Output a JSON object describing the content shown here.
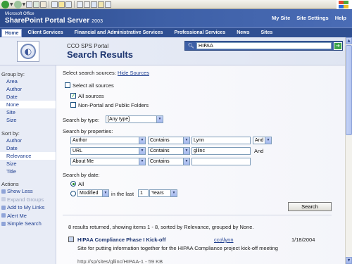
{
  "banner": {
    "brand_small": "Microsoft Office",
    "brand_large": "SharePoint Portal Server",
    "brand_year": "2003",
    "links": [
      "My Site",
      "Site Settings",
      "Help"
    ]
  },
  "nav": {
    "items": [
      "Home",
      "Client Services",
      "Financial and Administrative Services",
      "Professional Services",
      "News",
      "Sites"
    ]
  },
  "header": {
    "portal_title": "CCO SPS Portal",
    "page_title": "Search Results",
    "search_value": "HIPAA",
    "search_go_icon": "arrow-right-icon"
  },
  "sidebar": {
    "group_by_heading": "Group by:",
    "group_by": [
      "Area",
      "Author",
      "Date",
      "None",
      "Site",
      "Size"
    ],
    "group_by_selected": "None",
    "sort_by_heading": "Sort by:",
    "sort_by": [
      "Author",
      "Date",
      "Relevance",
      "Size",
      "Title"
    ],
    "sort_by_selected": "Relevance",
    "actions_heading": "Actions",
    "actions": [
      "Show Less",
      "Expand Groups",
      "Add to My Links",
      "Alert Me",
      "Simple Search"
    ]
  },
  "main": {
    "sources_label": "Select search sources:",
    "hide_sources": "Hide Sources",
    "select_all_sources": "Select all sources",
    "all_sources": "All sources",
    "non_portal": "Non-Portal and Public Folders",
    "search_by_type_label": "Search by type:",
    "type_value": "[Any type]",
    "search_by_properties_label": "Search by properties:",
    "properties": [
      {
        "property": "Author",
        "operator": "Contains",
        "value": "Lynn",
        "connector": "And"
      },
      {
        "property": "URL",
        "operator": "Contains",
        "value": "gllinc",
        "connector": "And"
      },
      {
        "property": "About Me",
        "operator": "Contains",
        "value": "",
        "connector": ""
      }
    ],
    "search_by_date_label": "Search by date:",
    "date_all": "All",
    "date_modified": "Modified",
    "date_in_the_last": "in the last",
    "date_count": "1",
    "date_unit": "Years",
    "search_button": "Search",
    "results_summary": "8 results returned, showing items 1 - 8, sorted by Relevance, grouped by None.",
    "results": [
      {
        "title": "HIPAA Compliance Phase I Kick-off",
        "author": "cco\\lynn",
        "date": "1/18/2004",
        "description": "Site for putting information together for the HIPAA Compliance project kick-off meeting",
        "meta": "http://sp/sites/gllinc/HIPAA-1 - 59 KB"
      }
    ]
  },
  "colors": {
    "banner": "#3d5fa6",
    "nav": "#2f4f92",
    "link": "#1d3d8f",
    "title": "#1d3570"
  }
}
